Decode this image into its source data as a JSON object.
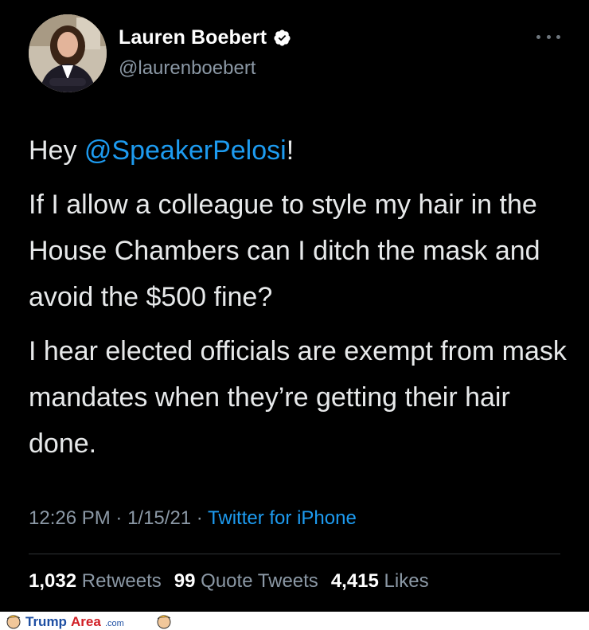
{
  "author": {
    "display_name": "Lauren Boebert",
    "handle": "@laurenboebert",
    "verified": true
  },
  "tweet": {
    "greeting_prefix": "Hey ",
    "mention": "@SpeakerPelosi",
    "greeting_suffix": "!",
    "paragraph_2": "If I allow a colleague to style my hair in the House Chambers can I ditch the mask and avoid the $500 fine?",
    "paragraph_3": "I hear elected officials are exempt from mask mandates when they’re getting their hair done."
  },
  "meta": {
    "time": "12:26 PM",
    "separator": " · ",
    "date": "1/15/21",
    "source": "Twitter for iPhone"
  },
  "stats": {
    "retweets_count": "1,032",
    "retweets_label": "Retweets",
    "quotes_count": "99",
    "quotes_label": "Quote Tweets",
    "likes_count": "4,415",
    "likes_label": "Likes"
  },
  "watermark": {
    "text": "TrumpArea.com"
  },
  "colors": {
    "background": "#000000",
    "accent": "#1d9bf0",
    "muted": "#8b98a5",
    "text": "#e7e9ea"
  },
  "icons": {
    "verified": "verified-badge-icon",
    "more": "more-horizontal-icon"
  }
}
